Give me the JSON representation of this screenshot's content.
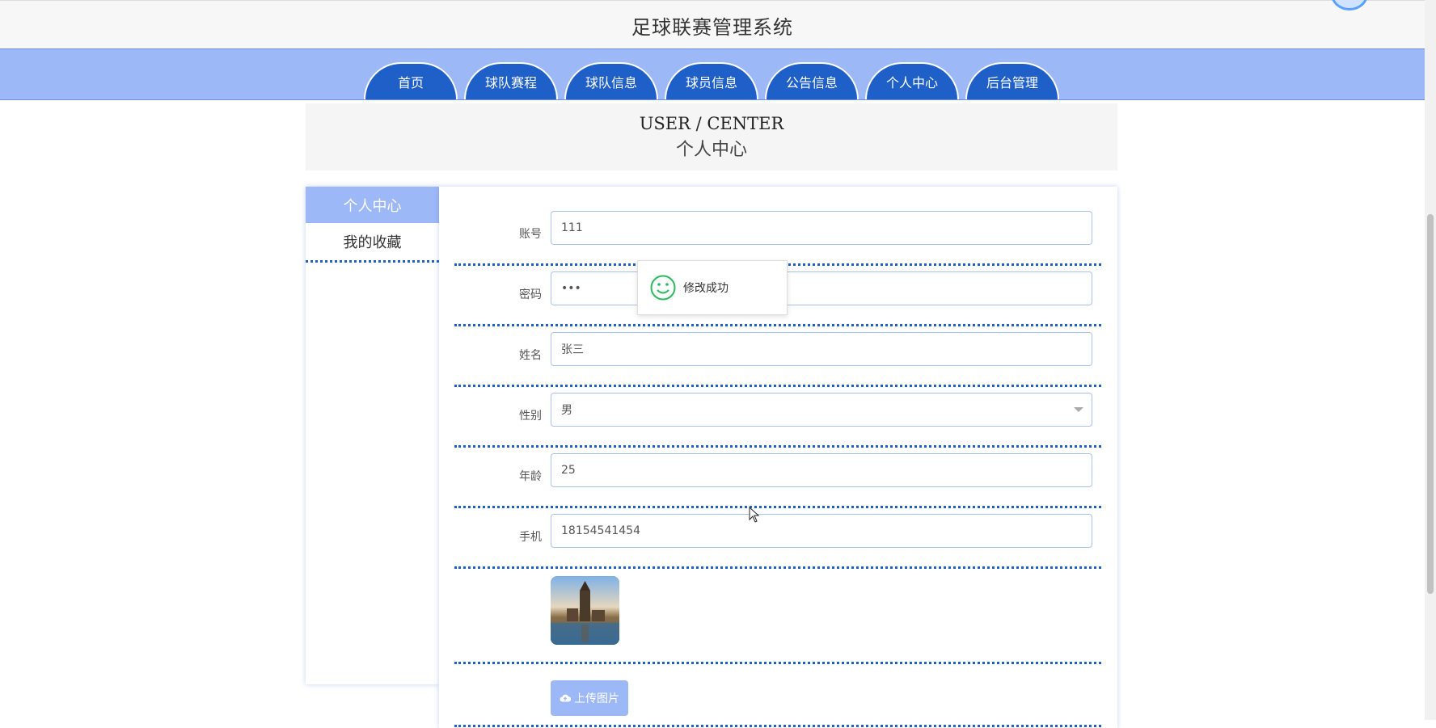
{
  "header": {
    "title": "足球联赛管理系统"
  },
  "nav": {
    "items": [
      {
        "label": "首页"
      },
      {
        "label": "球队赛程"
      },
      {
        "label": "球队信息"
      },
      {
        "label": "球员信息"
      },
      {
        "label": "公告信息"
      },
      {
        "label": "个人中心"
      },
      {
        "label": "后台管理"
      }
    ]
  },
  "banner": {
    "en": "USER / CENTER",
    "cn": "个人中心"
  },
  "sidebar": {
    "items": [
      {
        "label": "个人中心",
        "active": true
      },
      {
        "label": "我的收藏",
        "active": false
      }
    ]
  },
  "form": {
    "account": {
      "label": "账号",
      "value": "111"
    },
    "password": {
      "label": "密码",
      "value": "•••"
    },
    "name": {
      "label": "姓名",
      "value": "张三"
    },
    "gender": {
      "label": "性别",
      "value": "男"
    },
    "age": {
      "label": "年龄",
      "value": "25"
    },
    "phone": {
      "label": "手机",
      "value": "18154541454"
    },
    "upload_label": "上传图片"
  },
  "toast": {
    "message": "修改成功"
  },
  "colors": {
    "nav_bg": "#9cb8f6",
    "tab_bg": "#1e5fc8",
    "accent": "#9cb8f6",
    "dots": "#1e5fc8",
    "toast_icon": "#2bbb5c"
  },
  "icons": {
    "toast": "smile-icon",
    "upload": "cloud-upload-icon",
    "dropdown": "caret-down-icon"
  }
}
